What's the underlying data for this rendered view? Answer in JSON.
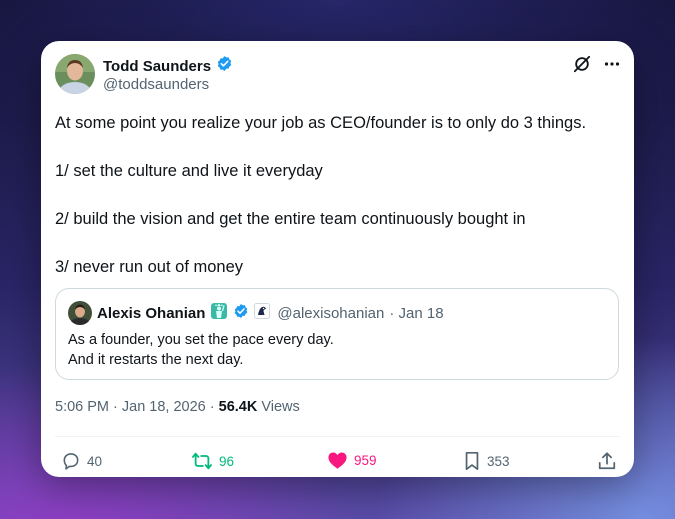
{
  "tweet": {
    "author_name": "Todd Saunders",
    "author_handle": "@toddsaunders",
    "verified": true,
    "text_lines": [
      "At some point you realize your job as CEO/founder is to only do 3 things.",
      "1/ set the culture and live it everyday",
      "2/ build the vision and get the entire team continuously bought in",
      "3/ never run out of money"
    ],
    "time": "5:06 PM · Jan 18, 2026 ·",
    "views_count": "56.4K",
    "views_label": "Views"
  },
  "quote": {
    "author_name": "Alexis Ohanian",
    "author_handle": "@alexisohanian",
    "date": "· Jan 18",
    "line1": "As a founder, you set the pace every day.",
    "line2": "And it restarts the next day."
  },
  "actions": {
    "replies": "40",
    "reposts": "96",
    "likes": "959",
    "bookmarks": "353"
  },
  "colors": {
    "verified": "#1d9bf0",
    "repost": "#00ba7c",
    "like": "#f91880",
    "muted": "#536471"
  },
  "icons": [
    "x-logo-icon",
    "more-icon",
    "verified-badge-icon",
    "statue-of-liberty-emoji",
    "affiliate-badge-icon",
    "reply-icon",
    "repost-icon",
    "heart-icon",
    "bookmark-icon",
    "share-icon"
  ]
}
